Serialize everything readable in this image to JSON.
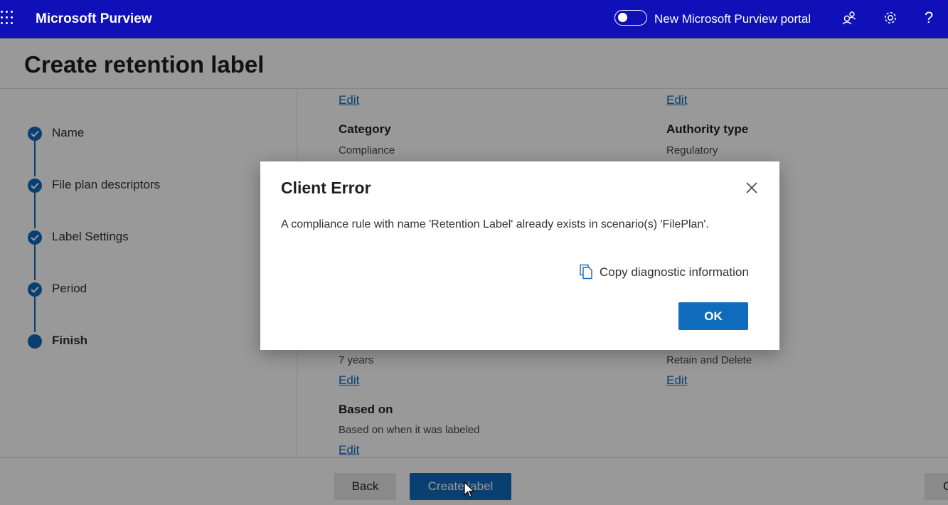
{
  "app": {
    "name": "Microsoft Purview",
    "portal_toggle_label": "New Microsoft Purview portal",
    "help_glyph": "?",
    "icons": [
      "waffle-menu-icon",
      "people-icon",
      "gear-icon",
      "help-icon"
    ]
  },
  "page": {
    "title": "Create retention label"
  },
  "steps": [
    {
      "label": "Name",
      "state": "completed"
    },
    {
      "label": "File plan descriptors",
      "state": "completed"
    },
    {
      "label": "Label Settings",
      "state": "completed"
    },
    {
      "label": "Period",
      "state": "completed"
    },
    {
      "label": "Finish",
      "state": "current"
    }
  ],
  "review": {
    "edit_label": "Edit",
    "category": {
      "title": "Category",
      "value": "Compliance"
    },
    "authority_type": {
      "title": "Authority type",
      "value": "Regulatory"
    },
    "period_value": "7 years",
    "action_value": "Retain and Delete",
    "based_on": {
      "title": "Based on",
      "value": "Based on when it was labeled"
    }
  },
  "footer": {
    "back_label": "Back",
    "create_label": "Create label",
    "right_partial_label": "C"
  },
  "dialog": {
    "title": "Client Error",
    "message": "A compliance rule with name 'Retention Label' already exists in scenario(s) 'FilePlan'.",
    "copy_label": "Copy diagnostic information",
    "ok_label": "OK"
  },
  "colors": {
    "topbar": "#0f10b8",
    "accent": "#0f6cbd",
    "overlay": "rgba(0,0,0,0.40)"
  }
}
